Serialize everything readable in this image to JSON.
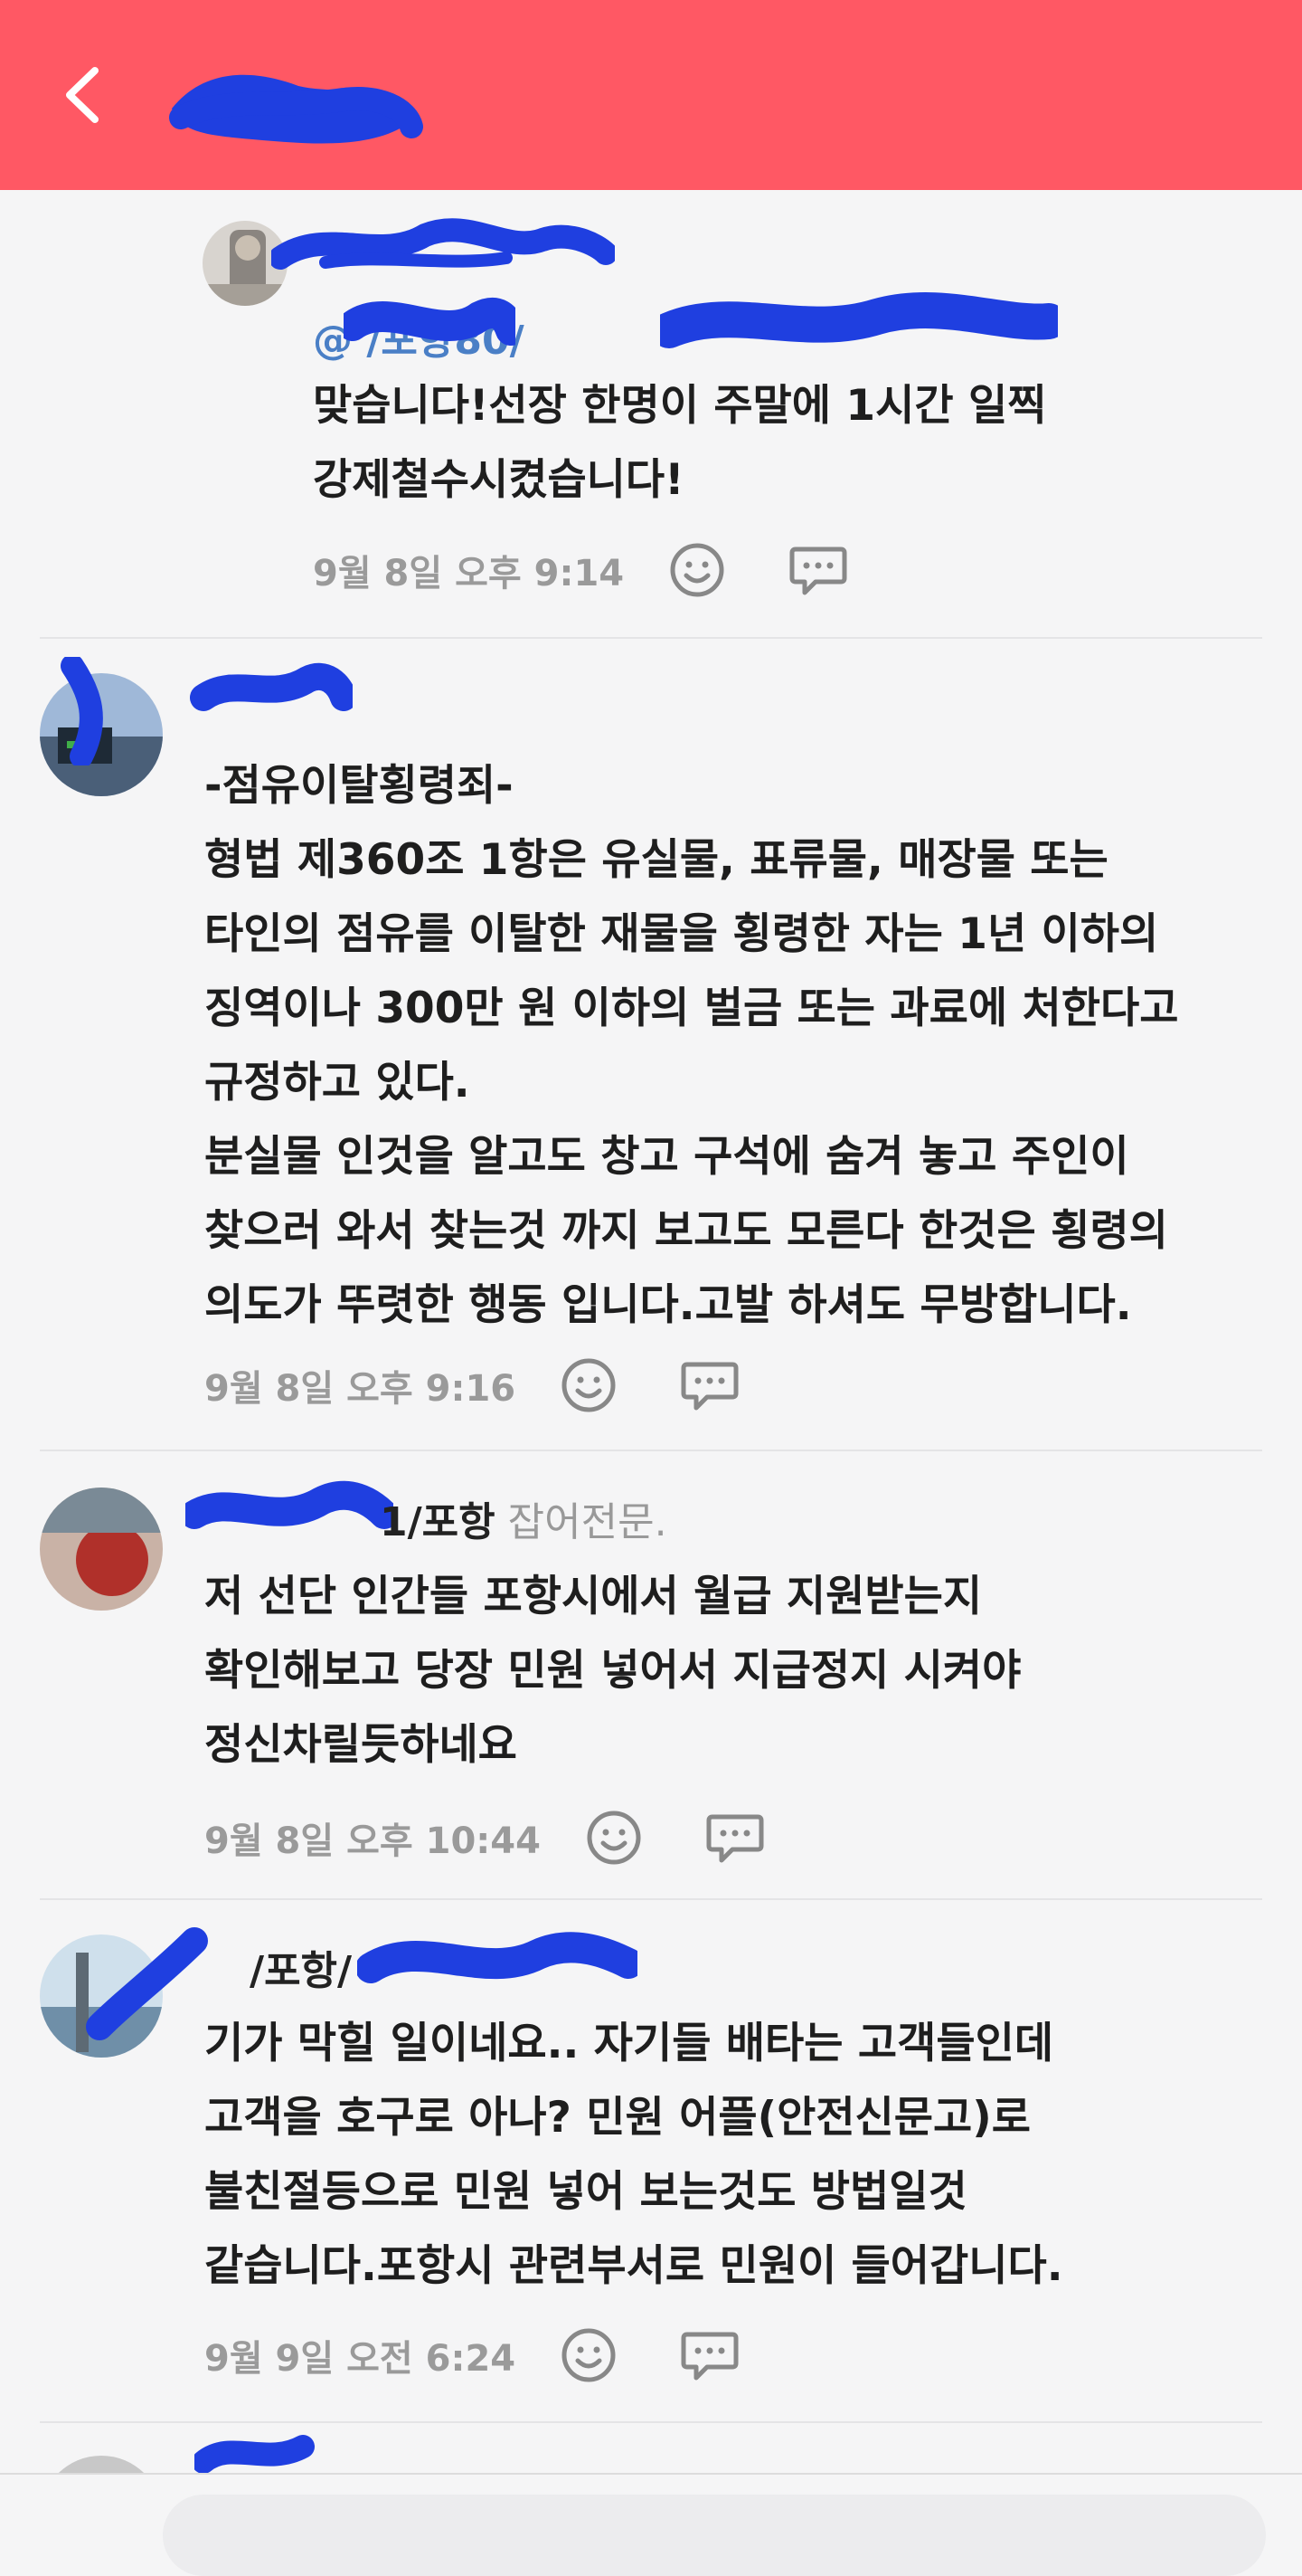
{
  "header": {
    "background_color": "#ff5864",
    "back_icon": "chevron-left-icon"
  },
  "comments": [
    {
      "mention": "@   /포항80/",
      "body": "맞습니다!선장 한명이 주말에 1시간 일찍\n강제철수시켰습니다!",
      "time": "9월 8일 오후 9:14"
    },
    {
      "body": "-점유이탈횡령죄-\n형법 제360조 1항은 유실물, 표류물, 매장물 또는\n타인의 점유를 이탈한 재물을 횡령한 자는 1년 이하의\n징역이나 300만 원 이하의 벌금 또는 과료에 처한다고\n규정하고 있다.\n분실물 인것을 알고도 창고 구석에 숨겨 놓고 주인이\n찾으러 와서 찾는것 까지 보고도 모른다 한것은 횡령의\n의도가 뚜렷한 행동 입니다.고발 하셔도 무방합니다.",
      "time": "9월 8일 오후 9:16"
    },
    {
      "name": "1/포항",
      "badge": "잡어전문.",
      "body": "저 선단 인간들 포항시에서 월급 지원받는지\n확인해보고 당장 민원 넣어서 지급정지 시켜야\n정신차릴듯하네요",
      "time": "9월 8일 오후 10:44"
    },
    {
      "name": "/포항/",
      "body": "기가 막힐 일이네요.. 자기들 배타는 고객들인데\n고객을 호구로 아나? 민원 어플(안전신문고)로\n불친절등으로 민원 넣어 보는것도  방법일것\n같습니다.포항시 관련부서로 민원이 들어갑니다.",
      "time": "9월 9일 오전 6:24"
    }
  ],
  "icons": {
    "emoji": "smiley-icon",
    "reply": "speech-bubble-icon"
  }
}
